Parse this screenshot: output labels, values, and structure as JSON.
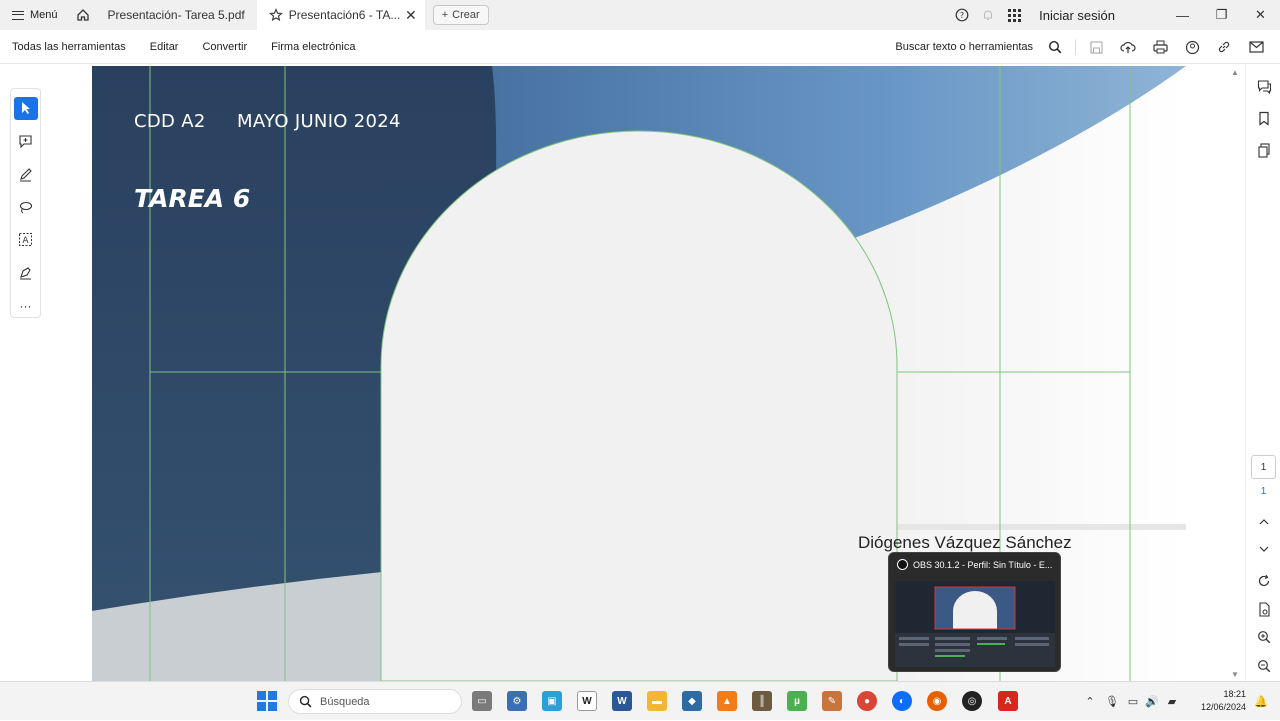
{
  "tabbar": {
    "menu_label": "Menú",
    "tabs": [
      {
        "label": "Presentación- Tarea 5.pdf"
      },
      {
        "label": "Presentación6 - TA..."
      }
    ],
    "create_label": "Crear",
    "signin_label": "Iniciar sesión"
  },
  "toolbar": {
    "items": [
      "Todas las herramientas",
      "Editar",
      "Convertir",
      "Firma electrónica"
    ],
    "search_label": "Buscar texto o herramientas"
  },
  "slide": {
    "code": "CDD A2",
    "dates": "MAYO JUNIO 2024",
    "title": "TAREA 6",
    "author": "Diógenes Vázquez Sánchez",
    "colors": {
      "navy": "#2b4262",
      "sky": "#5f8fbf",
      "arch": "#f1f1f1",
      "guide": "#7fc47f"
    }
  },
  "rail": {
    "current_page": "1",
    "total_pages": "1"
  },
  "obs_popup": {
    "title": "OBS 30.1.2 - Perfil: Sin Título - E..."
  },
  "taskbar": {
    "search_placeholder": "Búsqueda",
    "time": "18:21",
    "date": "12/06/2024"
  }
}
